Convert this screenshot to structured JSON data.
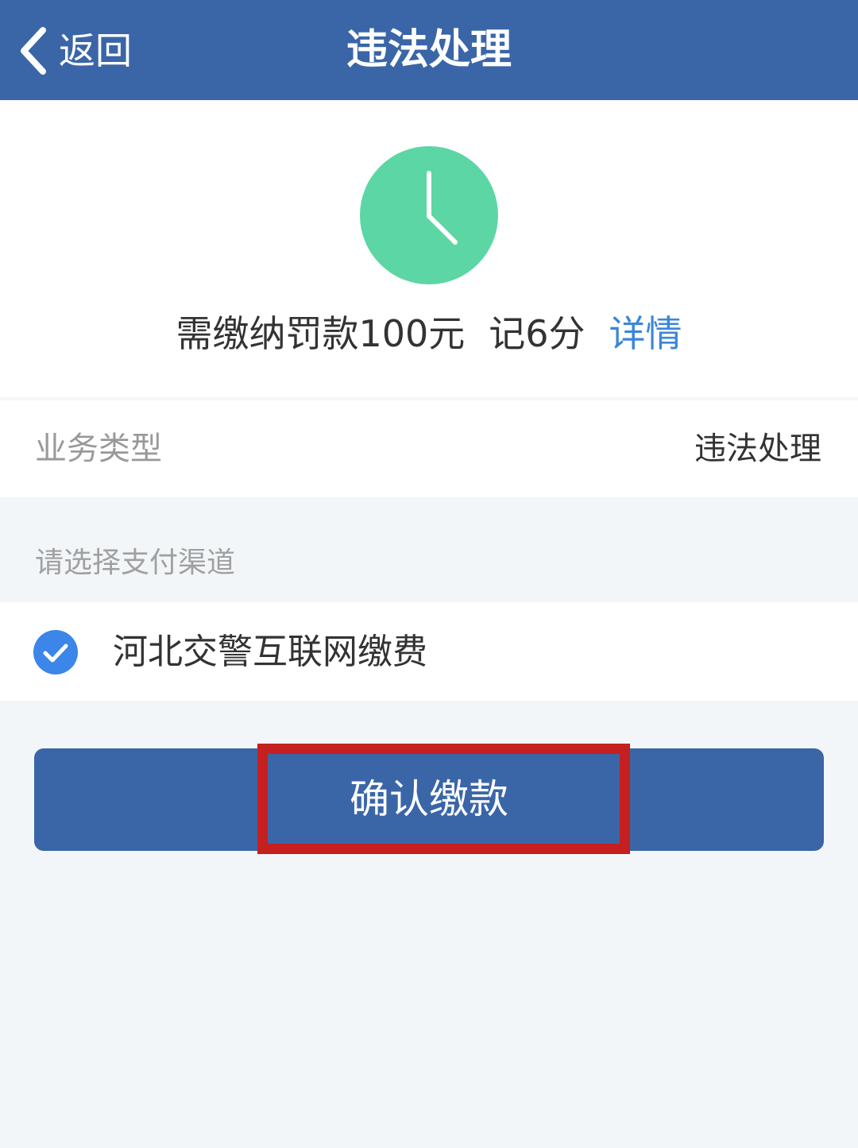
{
  "nav": {
    "back_label": "返回",
    "title": "违法处理"
  },
  "status": {
    "icon": "clock-icon",
    "icon_color": "#5cd6a4",
    "fine_text": "需缴纳罚款100元",
    "points_text": "记6分",
    "detail_link": "详情"
  },
  "business": {
    "label": "业务类型",
    "value": "违法处理"
  },
  "payment": {
    "section_label": "请选择支付渠道",
    "channels": [
      {
        "label": "河北交警互联网缴费",
        "selected": true
      }
    ]
  },
  "confirm_button": {
    "label": "确认缴款"
  },
  "colors": {
    "primary": "#3a66a8",
    "link": "#3b86d9",
    "check": "#3b86e8",
    "highlight": "#c51f1f",
    "background": "#f3f6f8"
  }
}
